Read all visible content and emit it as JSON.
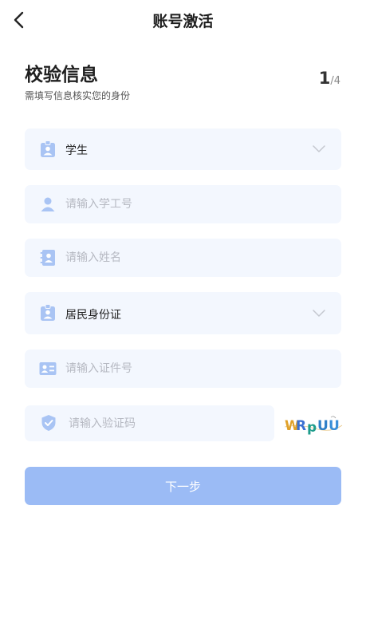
{
  "nav": {
    "title": "账号激活"
  },
  "header": {
    "title": "校验信息",
    "subtitle": "需填写信息核实您的身份",
    "step_current": "1",
    "step_separator": "/",
    "step_total": "4"
  },
  "form": {
    "identity_type": {
      "value": "学生"
    },
    "student_id": {
      "placeholder": "请输入学工号"
    },
    "name": {
      "placeholder": "请输入姓名"
    },
    "id_type": {
      "value": "居民身份证"
    },
    "id_number": {
      "placeholder": "请输入证件号"
    },
    "verify_code": {
      "placeholder": "请输入验证码"
    },
    "captcha_text": "WRpUU"
  },
  "actions": {
    "next_label": "下一步"
  },
  "colors": {
    "accent": "#9bbbf5",
    "field_bg": "#f3f7fe",
    "icon": "#a9c4f4",
    "placeholder": "#b6b9c2"
  }
}
